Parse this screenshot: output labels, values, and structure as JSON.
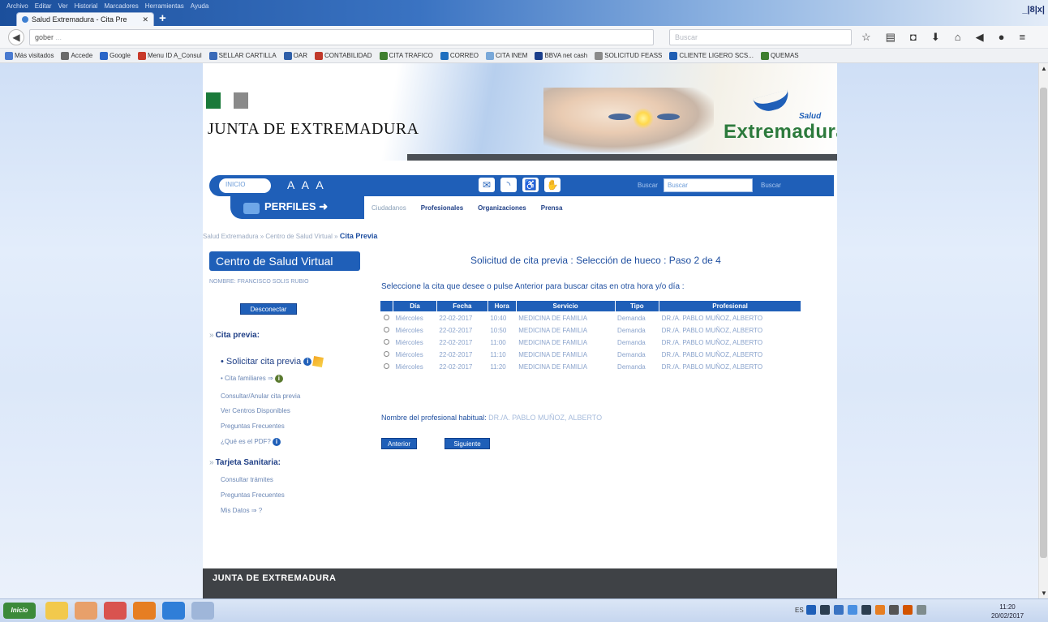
{
  "browser": {
    "menu": [
      "Archivo",
      "Editar",
      "Ver",
      "Historial",
      "Marcadores",
      "Herramientas",
      "Ayuda"
    ],
    "tab_title": "Salud Extremadura - Cita Pre",
    "window_controls": "_|8|x|",
    "url_prefix": "gober",
    "url_rest": "...",
    "search_placeholder": "Buscar",
    "bookmarks": [
      {
        "label": "Más visitados",
        "color": "#4a7bd0"
      },
      {
        "label": "Accede",
        "color": "#6b6b6b"
      },
      {
        "label": "Google",
        "color": "#2a66c8"
      },
      {
        "label": "Menu ID A_Consul",
        "color": "#c83a2a"
      },
      {
        "label": "SELLAR CARTILLA",
        "color": "#3a6ab8"
      },
      {
        "label": "OAR",
        "color": "#2f5fa8"
      },
      {
        "label": "CONTABILIDAD",
        "color": "#c0392b"
      },
      {
        "label": "CITA TRAFICO",
        "color": "#3f7f2f"
      },
      {
        "label": "CORREO",
        "color": "#1f6fbf"
      },
      {
        "label": "CITA INEM",
        "color": "#79a8d9"
      },
      {
        "label": "BBVA net cash",
        "color": "#1b3f8c"
      },
      {
        "label": "SOLICITUD FEASS",
        "color": "#8a8a8a"
      },
      {
        "label": "CLIENTE LIGERO SCS...",
        "color": "#1e5db3"
      },
      {
        "label": "QUEMAS",
        "color": "#3f7f2f"
      }
    ]
  },
  "site": {
    "junta_title": "JUNTA DE EXTREMADURA",
    "logo_word": "Extremadura",
    "logo_salud": "Salud",
    "inicio": "INICIO",
    "font_size": "A A A",
    "search_label": "Buscar",
    "search_value": "Buscar",
    "search_button": "Buscar",
    "perfiles": "PERFILES",
    "profile_links": [
      "Ciudadanos",
      "Profesionales",
      "Organizaciones",
      "Prensa"
    ],
    "breadcrumb_prev": "Salud Extremadura » Centro de Salud Virtual »",
    "breadcrumb_current": "Cita Previa",
    "footer": "JUNTA DE EXTREMADURA"
  },
  "sidebar": {
    "title": "Centro de Salud Virtual",
    "user": "NOMBRE: FRANCISCO SOLIS RUBIO",
    "desconectar": "Desconectar",
    "cita_previa": "Cita previa:",
    "solicitar": "Solicitar cita previa",
    "cita_familiares": "Cita familiares",
    "consultar": "Consultar/Anular cita previa",
    "ver_centros": "Ver Centros Disponibles",
    "preguntas": "Preguntas Frecuentes",
    "que_es": "¿Qué es el PDF?",
    "tarjeta": "Tarjeta Sanitaria:",
    "consultar_tramites": "Consultar trámites",
    "preguntas2": "Preguntas Frecuentes",
    "mis_datos": "Mis Datos"
  },
  "main": {
    "title": "Solicitud de cita previa : Selección de hueco : Paso 2 de 4",
    "instruction": "Seleccione la cita que desee o pulse Anterior para buscar citas en otra hora y/o día :",
    "columns": [
      "Día",
      "Fecha",
      "Hora",
      "Servicio",
      "Tipo",
      "Profesional"
    ],
    "rows": [
      {
        "dia": "Miércoles",
        "fecha": "22-02-2017",
        "hora": "10:40",
        "servicio": "MEDICINA DE FAMILIA",
        "tipo": "Demanda",
        "profesional": "DR./A. PABLO MUÑOZ, ALBERTO"
      },
      {
        "dia": "Miércoles",
        "fecha": "22-02-2017",
        "hora": "10:50",
        "servicio": "MEDICINA DE FAMILIA",
        "tipo": "Demanda",
        "profesional": "DR./A. PABLO MUÑOZ, ALBERTO"
      },
      {
        "dia": "Miércoles",
        "fecha": "22-02-2017",
        "hora": "11:00",
        "servicio": "MEDICINA DE FAMILIA",
        "tipo": "Demanda",
        "profesional": "DR./A. PABLO MUÑOZ, ALBERTO"
      },
      {
        "dia": "Miércoles",
        "fecha": "22-02-2017",
        "hora": "11:10",
        "servicio": "MEDICINA DE FAMILIA",
        "tipo": "Demanda",
        "profesional": "DR./A. PABLO MUÑOZ, ALBERTO"
      },
      {
        "dia": "Miércoles",
        "fecha": "22-02-2017",
        "hora": "11:20",
        "servicio": "MEDICINA DE FAMILIA",
        "tipo": "Demanda",
        "profesional": "DR./A. PABLO MUÑOZ, ALBERTO"
      }
    ],
    "habitual_label": "Nombre del profesional habitual:",
    "habitual_value": "DR./A. PABLO MUÑOZ, ALBERTO",
    "anterior": "Anterior",
    "siguiente": "Siguiente"
  },
  "taskbar": {
    "start": "Inicio",
    "lang": "ES",
    "time": "11:20",
    "date": "20/02/2017"
  },
  "colors": {
    "brand_blue": "#1f5fb8",
    "brand_green": "#2c7a3c"
  }
}
